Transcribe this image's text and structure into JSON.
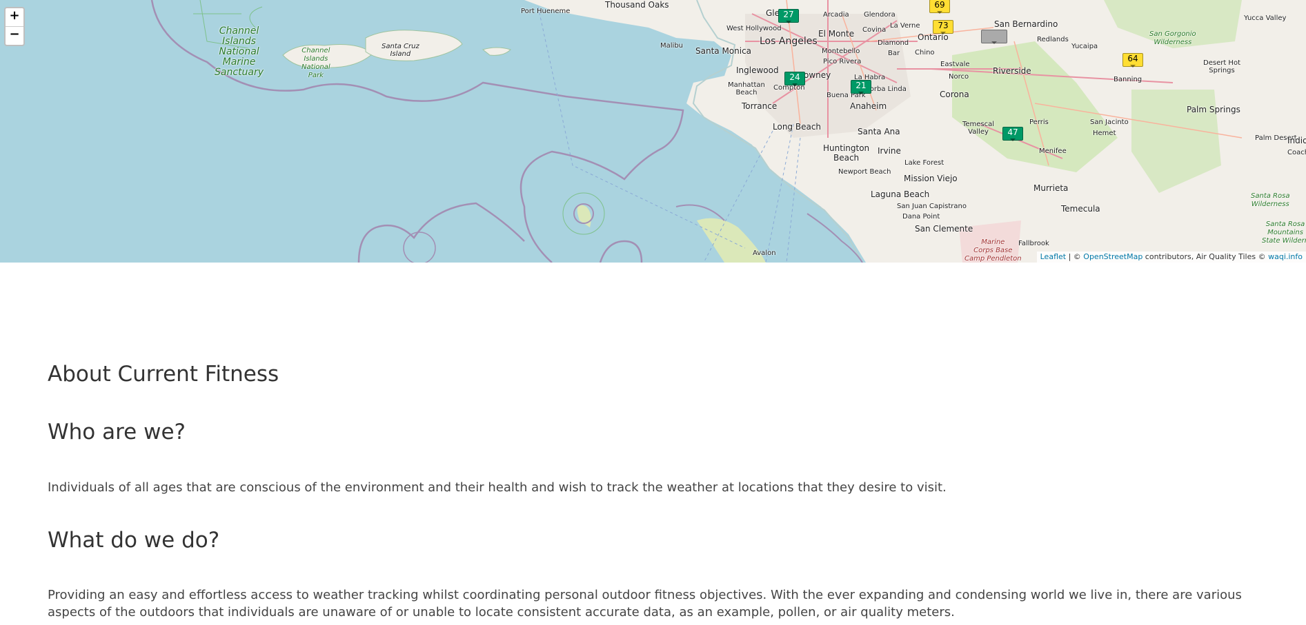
{
  "map": {
    "zoom_in": "+",
    "zoom_out": "−",
    "markers": [
      {
        "value": "27",
        "level": "good"
      },
      {
        "value": "69",
        "level": "moderate"
      },
      {
        "value": "73",
        "level": "moderate"
      },
      {
        "value": "",
        "level": "none"
      },
      {
        "value": "64",
        "level": "moderate"
      },
      {
        "value": "24",
        "level": "good"
      },
      {
        "value": "21",
        "level": "good"
      },
      {
        "value": "47",
        "level": "good"
      }
    ],
    "labels": {
      "thousand_oaks": "Thousand Oaks",
      "port_hueneme": "Port Hueneme",
      "glendale": "Gle",
      "arcadia": "Arcadia",
      "glendora": "Glendora",
      "la_verne": "La Verne",
      "san_bernardino": "San Bernardino",
      "yucca_valley": "Yucca Valley",
      "west_hollywood": "West Hollywood",
      "el_monte": "El Monte",
      "covina": "Covina",
      "ontario": "Ontario",
      "redlands": "Redlands",
      "malibu": "Malibu",
      "los_angeles": "Los Angeles",
      "diamond": "Diamond",
      "yucaipa": "Yucaipa",
      "santa_monica": "Santa Monica",
      "montebello": "Montebello",
      "bar": "Bar",
      "chino": "Chino",
      "pico_rivera": "Pico Rivera",
      "eastvale": "Eastvale",
      "inglewood": "Inglewood",
      "downey": "owney",
      "la_habra": "La Habra",
      "riverside": "Riverside",
      "banning": "Banning",
      "desert_hot_springs": "Desert Hot\nSprings",
      "norco": "Norco",
      "manhattan_beach": "Manhattan\nBeach",
      "compton": "Compton",
      "yorba_linda": "Yorba Linda",
      "buena_park": "Buena Park",
      "corona": "Corona",
      "torrance": "Torrance",
      "anaheim": "Anaheim",
      "palm_springs": "Palm Springs",
      "long_beach": "Long Beach",
      "temescal_valley": "Temescal\nValley",
      "perris": "Perris",
      "san_jacinto": "San Jacinto",
      "hemet": "Hemet",
      "santa_ana": "Santa Ana",
      "palm_desert": "Palm Desert",
      "indio": "Indio",
      "coachella": "Coach",
      "huntington_beach": "Huntington\nBeach",
      "irvine": "Irvine",
      "menifee": "Menifee",
      "newport_beach": "Newport Beach",
      "lake_forest": "Lake Forest",
      "mission_viejo": "Mission Viejo",
      "murrieta": "Murrieta",
      "laguna_beach": "Laguna Beach",
      "san_juan_capistrano": "San Juan Capistrano",
      "dana_point": "Dana Point",
      "temecula": "Temecula",
      "san_clemente": "San Clemente",
      "fallbrook": "Fallbrook",
      "avalon": "Avalon",
      "channel_islands_sanctuary": "Channel\nIslands\nNational\nMarine\nSanctuary",
      "channel_islands_park": "Channel\nIslands\nNational\nPark",
      "santa_cruz_island": "Santa Cruz\nIsland",
      "san_gorgonio": "San Gorgonio\nWilderness",
      "santa_rosa_wilderness": "Santa Rosa\nWilderness",
      "santa_rosa_mountains": "Santa Rosa\nMountains\nState Wildern",
      "marine_corps": "Marine\nCorps Base\nCamp Pendleton"
    },
    "attribution": {
      "leaflet": "Leaflet",
      "sep1": " | © ",
      "osm": "OpenStreetMap",
      "middle": " contributors, Air Quality Tiles © ",
      "waqi": "waqi.info"
    }
  },
  "about": {
    "title": "About Current Fitness",
    "who_heading": "Who are we?",
    "who_text": "Individuals of all ages that are conscious of the environment and their health and wish to track the weather at locations that they desire to visit.",
    "what_heading": "What do we do?",
    "what_text": "Providing an easy and effortless access to weather tracking whilst coordinating personal outdoor fitness objectives. With the ever expanding and condensing world we live in, there are various aspects of the outdoors that individuals are unaware of or unable to locate consistent accurate data, as an example, pollen, or air quality meters."
  }
}
